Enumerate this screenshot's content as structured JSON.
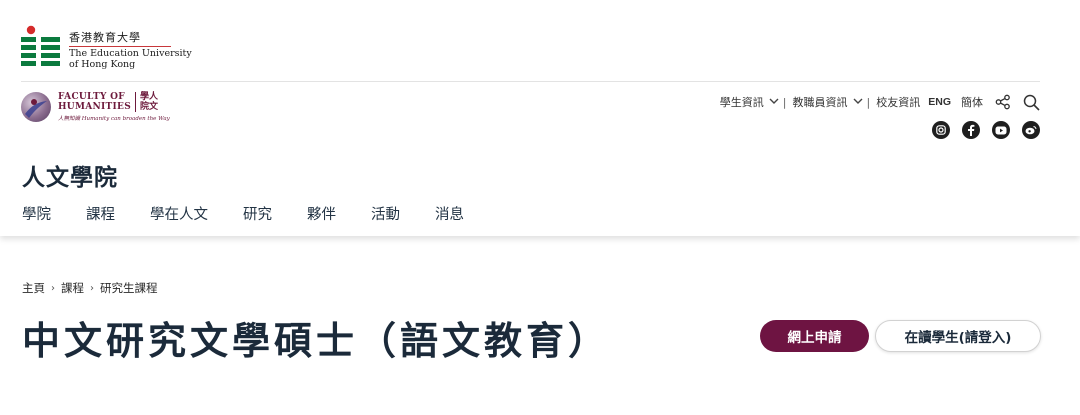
{
  "brand": {
    "eduhk_zh": "香港教育大學",
    "eduhk_en_line1": "The Education University",
    "eduhk_en_line2": "of Hong Kong",
    "colors": {
      "eduhk_green": "#0b7a3e",
      "eduhk_red": "#d52b2b"
    }
  },
  "faculty": {
    "en_line1": "FACULTY OF",
    "en_line2": "HUMANITIES",
    "zh_line1": "學人",
    "zh_line2": "院文",
    "tagline": "人無知識 Humanity can broaden the Way",
    "color": "#6d1a3c"
  },
  "utility_nav": {
    "students": "學生資訊",
    "staff": "教職員資訊",
    "alumni": "校友資訊",
    "eng": "ENG",
    "simplified": "簡体",
    "icons": [
      "share-icon",
      "search-icon"
    ]
  },
  "social": [
    "instagram-icon",
    "facebook-icon",
    "youtube-icon",
    "weibo-icon"
  ],
  "site_title": "人文學院",
  "main_nav": [
    "學院",
    "課程",
    "學在人文",
    "研究",
    "夥伴",
    "活動",
    "消息"
  ],
  "breadcrumb": [
    "主頁",
    "課程",
    "研究生課程"
  ],
  "page_title": "中文研究文學碩士（語文教育）",
  "buttons": {
    "apply": "網上申請",
    "student_login": "在讀學生(請登入)",
    "apply_color": "#6e1442"
  }
}
